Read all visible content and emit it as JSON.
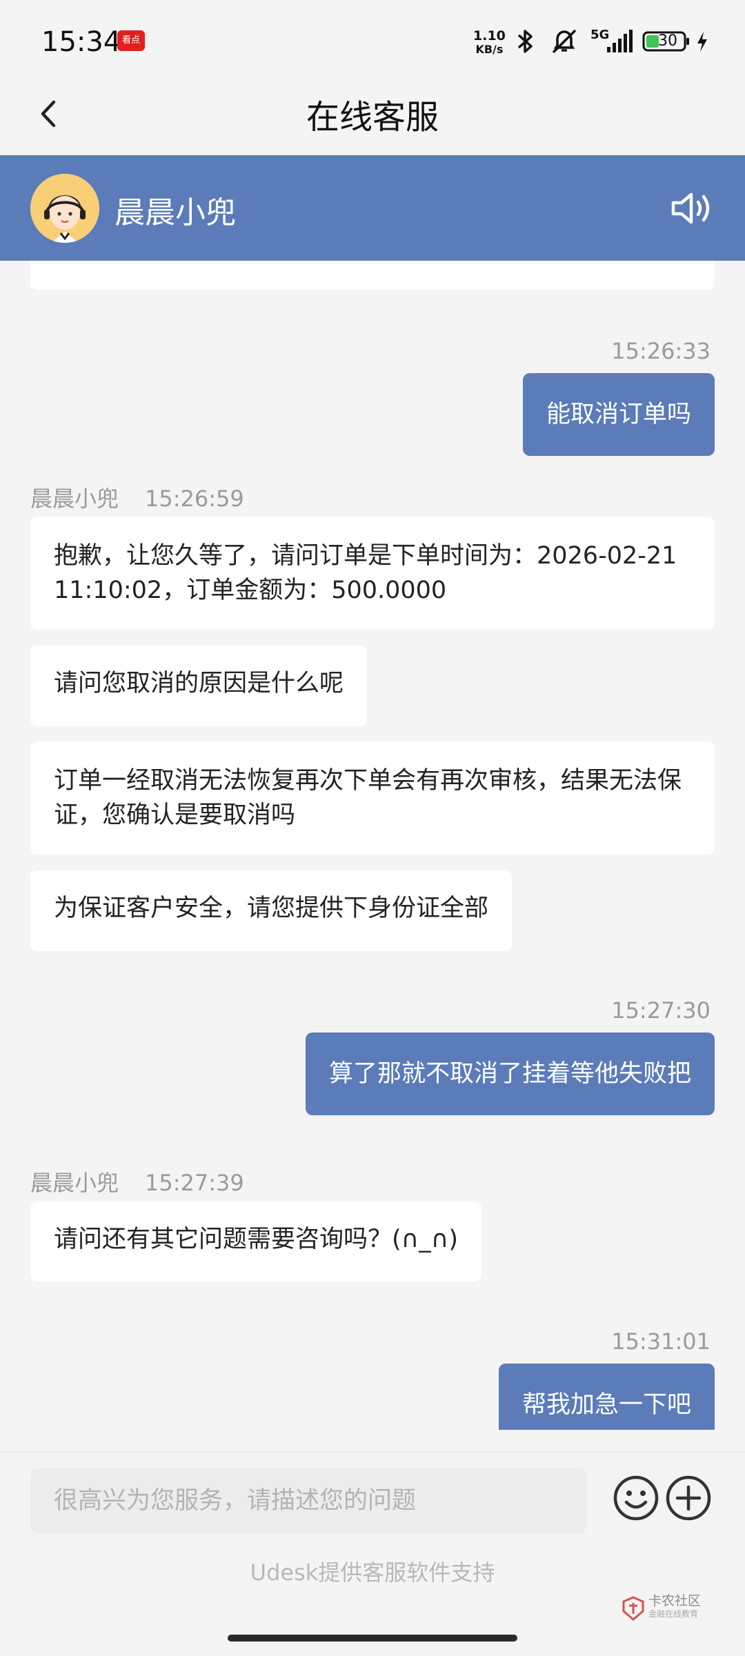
{
  "status_bar": {
    "time": "15:34",
    "app_badge": "看点",
    "net_speed_value": "1.10",
    "net_speed_unit": "KB/s",
    "network": "5G",
    "battery": "30"
  },
  "nav": {
    "title": "在线客服"
  },
  "agent": {
    "name": "晨晨小兜"
  },
  "messages": {
    "ts1": "15:26:33",
    "user1": "能取消订单吗",
    "sender1": "晨晨小兜",
    "ts2": "15:26:59",
    "agent1": "抱歉，让您久等了，请问订单是下单时间为：2026-02-21 11:10:02，订单金额为：500.0000",
    "agent2": "请问您取消的原因是什么呢",
    "agent3": "订单一经取消无法恢复再次下单会有再次审核，结果无法保证，您确认是要取消吗",
    "agent4": "为保证客户安全，请您提供下身份证全部",
    "ts3": "15:27:30",
    "user2": "算了那就不取消了挂着等他失败把",
    "sender2": "晨晨小兜",
    "ts4": "15:27:39",
    "agent5": "请问还有其它问题需要咨询吗？(∩_∩)",
    "ts5": "15:31:01",
    "user3": "帮我加急一下吧"
  },
  "input": {
    "placeholder": "很高兴为您服务，请描述您的问题",
    "value": ""
  },
  "footer": {
    "powered_by": "Udesk提供客服软件支持"
  },
  "watermark": {
    "title": "卡农社区",
    "subtitle": "金融在线教育"
  },
  "icons": {
    "back": "chevron-left-icon",
    "speaker": "speaker-icon",
    "emoji": "smiley-icon",
    "plus": "plus-circle-icon",
    "bluetooth": "bluetooth-icon",
    "mute": "bell-off-icon",
    "signal": "signal-icon",
    "battery": "battery-icon"
  },
  "colors": {
    "accent": "#5b7bb9",
    "background": "#f4f4f4"
  }
}
